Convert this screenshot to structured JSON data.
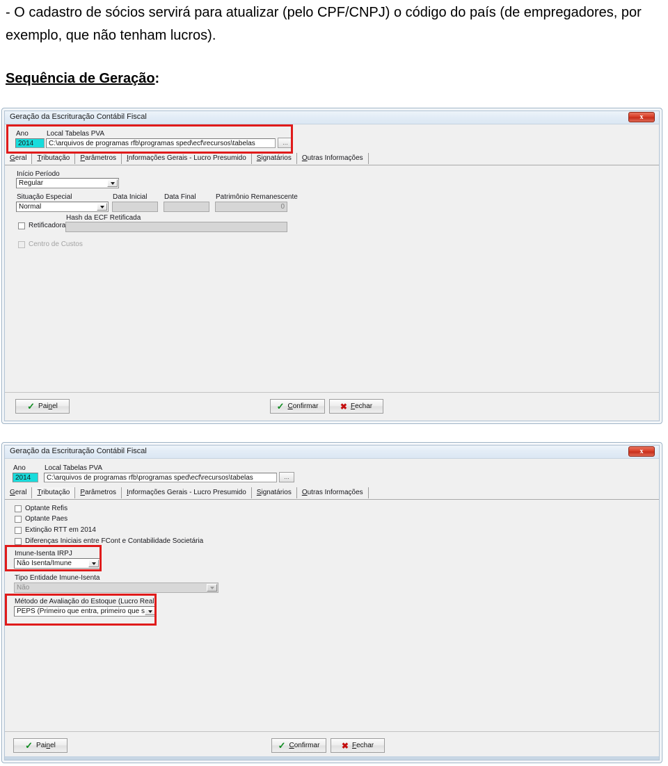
{
  "document": {
    "paragraph": "- O cadastro de sócios servirá para atualizar (pelo CPF/CNPJ) o código do país (de empregadores, por exemplo, que não tenham lucros).",
    "heading_underlined": "Sequência de Geração",
    "heading_suffix": ":"
  },
  "colors": {
    "annotation_red": "#e01b1b",
    "selection_cyan": "#18dcdc",
    "check_green": "#0f8b21",
    "x_red": "#c40f0f",
    "titlebar_blue": "#dbe7f3"
  },
  "dialog1": {
    "title": "Geração da Escrituração Contábil Fiscal",
    "close_label": "x",
    "ano_label": "Ano",
    "ano_value": "2014",
    "local_label": "Local Tabelas PVA",
    "local_value": "C:\\arquivos de programas rfb\\programas sped\\ecf\\recursos\\tabelas",
    "browse_label": "...",
    "tabs": [
      {
        "label": "Geral",
        "accel": "G",
        "rest": "eral",
        "active": true
      },
      {
        "label": "Tributação",
        "accel": "T",
        "rest": "ributação",
        "active": false
      },
      {
        "label": "Parâmetros",
        "accel": "P",
        "rest": "arâmetros",
        "active": false
      },
      {
        "label": "Informações Gerais - Lucro Presumido",
        "accel": "I",
        "rest": "nformações Gerais - Lucro Presumido",
        "active": false
      },
      {
        "label": "Signatários",
        "accel": "S",
        "rest": "ignatários",
        "active": false
      },
      {
        "label": "Outras Informações",
        "accel": "O",
        "rest": "utras Informações",
        "active": false
      }
    ],
    "inicio_periodo_label": "Início Período",
    "inicio_periodo_value": "Regular",
    "situacao_label": "Situação Especial",
    "situacao_value": "Normal",
    "data_inicial_label": "Data Inicial",
    "data_inicial_value": "",
    "data_final_label": "Data Final",
    "data_final_value": "",
    "patrimonio_label": "Patrimônio Remanescente",
    "patrimonio_value": "0",
    "hash_label": "Hash da ECF Retificada",
    "hash_value": "",
    "retificadora_label": "Retificadora",
    "centro_custos_label": "Centro de Custos",
    "buttons": {
      "painel": {
        "accel_pre": "Pai",
        "accel": "n",
        "accel_post": "el",
        "icon": "check-icon"
      },
      "confirmar": {
        "accel_pre": "",
        "accel": "C",
        "accel_post": "onfirmar",
        "icon": "check-icon"
      },
      "fechar": {
        "accel_pre": "",
        "accel": "F",
        "accel_post": "echar",
        "icon": "x-icon"
      }
    }
  },
  "dialog2": {
    "title": "Geração da Escrituração Contábil Fiscal",
    "close_label": "x",
    "ano_label": "Ano",
    "ano_value": "2014",
    "local_label": "Local Tabelas PVA",
    "local_value": "C:\\arquivos de programas rfb\\programas sped\\ecf\\recursos\\tabelas",
    "browse_label": "...",
    "tabs": [
      {
        "label": "Geral",
        "accel": "G",
        "rest": "eral",
        "active": false
      },
      {
        "label": "Tributação",
        "accel": "T",
        "rest": "ributação",
        "active": true
      },
      {
        "label": "Parâmetros",
        "accel": "P",
        "rest": "arâmetros",
        "active": false
      },
      {
        "label": "Informações Gerais - Lucro Presumido",
        "accel": "I",
        "rest": "nformações Gerais - Lucro Presumido",
        "active": false
      },
      {
        "label": "Signatários",
        "accel": "S",
        "rest": "ignatários",
        "active": false
      },
      {
        "label": "Outras Informações",
        "accel": "O",
        "rest": "utras Informações",
        "active": false
      }
    ],
    "checkboxes": [
      {
        "label": "Optante Refis",
        "checked": false,
        "disabled": false
      },
      {
        "label": "Optante Paes",
        "checked": false,
        "disabled": false
      },
      {
        "label": "Extinção RTT em 2014",
        "checked": false,
        "disabled": false
      },
      {
        "label": "Diferenças Iniciais entre FCont e Contabilidade Societária",
        "checked": false,
        "disabled": false
      }
    ],
    "imune_label": "Imune-Isenta IRPJ",
    "imune_value": "Não Isenta/Imune",
    "tipo_entidade_label": "Tipo Entidade Imune-Isenta",
    "tipo_entidade_value": "Não",
    "metodo_label": "Método de Avaliação do Estoque (Lucro Real)",
    "metodo_value": "PEPS (Primeiro que entra, primeiro que sai)",
    "buttons": {
      "painel": {
        "accel_pre": "Pai",
        "accel": "n",
        "accel_post": "el",
        "icon": "check-icon"
      },
      "confirmar": {
        "accel_pre": "",
        "accel": "C",
        "accel_post": "onfirmar",
        "icon": "check-icon"
      },
      "fechar": {
        "accel_pre": "",
        "accel": "F",
        "accel_post": "echar",
        "icon": "x-icon"
      }
    }
  }
}
